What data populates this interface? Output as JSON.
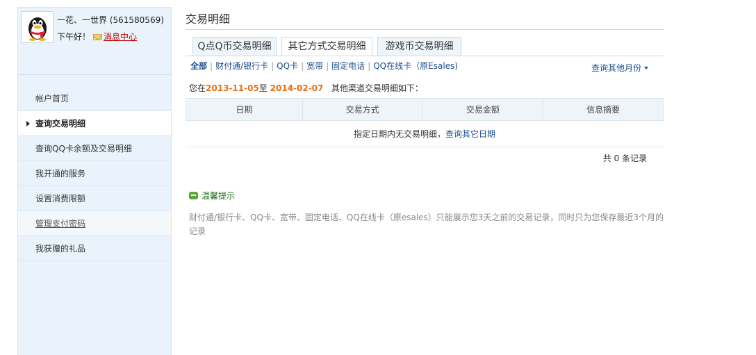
{
  "profile": {
    "username": "一花、一世界 (561580569)",
    "greeting": "下午好！",
    "message_center": "消息中心"
  },
  "sidebar": {
    "items": [
      {
        "label": "帐户首页"
      },
      {
        "label": "查询交易明细"
      },
      {
        "label": "查询QQ卡余额及交易明细"
      },
      {
        "label": "我开通的服务"
      },
      {
        "label": "设置消费限额"
      },
      {
        "label": "管理支付密码"
      },
      {
        "label": "我获赠的礼品"
      }
    ]
  },
  "main": {
    "title": "交易明细",
    "tabs": [
      {
        "label": "Q点Q币交易明细"
      },
      {
        "label": "其它方式交易明细"
      },
      {
        "label": "游戏币交易明细"
      }
    ],
    "filters": [
      {
        "label": "全部"
      },
      {
        "label": "财付通/银行卡"
      },
      {
        "label": "QQ卡"
      },
      {
        "label": "宽带"
      },
      {
        "label": "固定电话"
      },
      {
        "label": "QQ在线卡（原Esales)"
      }
    ],
    "other_months": "查询其他月份",
    "range": {
      "prefix": "您在",
      "start": "2013-11-05",
      "middle": "至",
      "end": "2014-02-07",
      "suffix": "其他渠道交易明细如下："
    },
    "table": {
      "headers": [
        "日期",
        "交易方式",
        "交易金额",
        "信息摘要"
      ],
      "empty_text": "指定日期内无交易明细，",
      "empty_link": "查询其它日期"
    },
    "total": "共 0 条记录",
    "tip": {
      "title": "温馨提示",
      "text": "财付通/银行卡、QQ卡、宽带、固定电话、QQ在线卡（原esales）只能展示您3天之前的交易记录，同时只为您保存最近3个月的记录"
    }
  }
}
